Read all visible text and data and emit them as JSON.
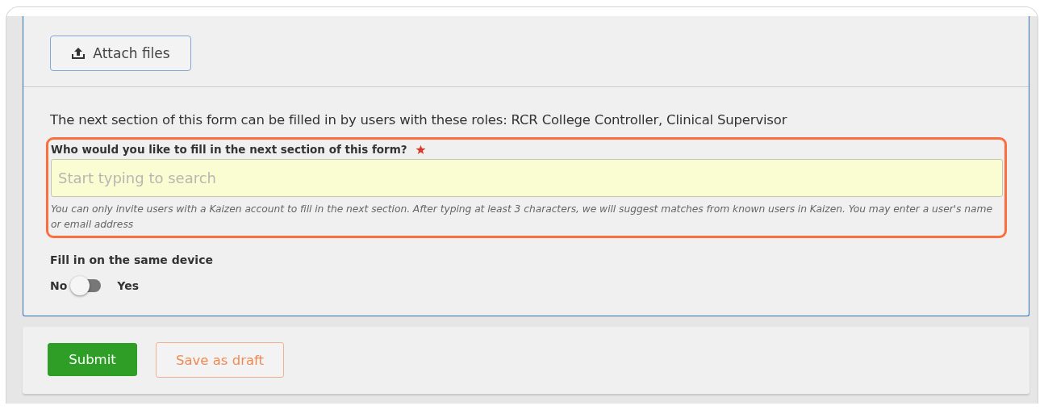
{
  "attach_button": {
    "label": "Attach files"
  },
  "roles_text": "The next section of this form can be filled in by users with these roles: RCR College Controller, Clinical Supervisor",
  "assignee_field": {
    "label": "Who would you like to fill in the next section of this form?",
    "required": true,
    "placeholder": "Start typing to search",
    "help": "You can only invite users with a Kaizen account to fill in the next section. After typing at least 3 characters, we will suggest matches from known users in Kaizen. You may enter a user's name or email address",
    "highlighted": true
  },
  "same_device": {
    "label": "Fill in on the same device",
    "off_label": "No",
    "on_label": "Yes",
    "on": false
  },
  "buttons": [
    {
      "kind": "primary",
      "label": "Submit"
    },
    {
      "kind": "secondary",
      "label": "Save as draft"
    }
  ]
}
